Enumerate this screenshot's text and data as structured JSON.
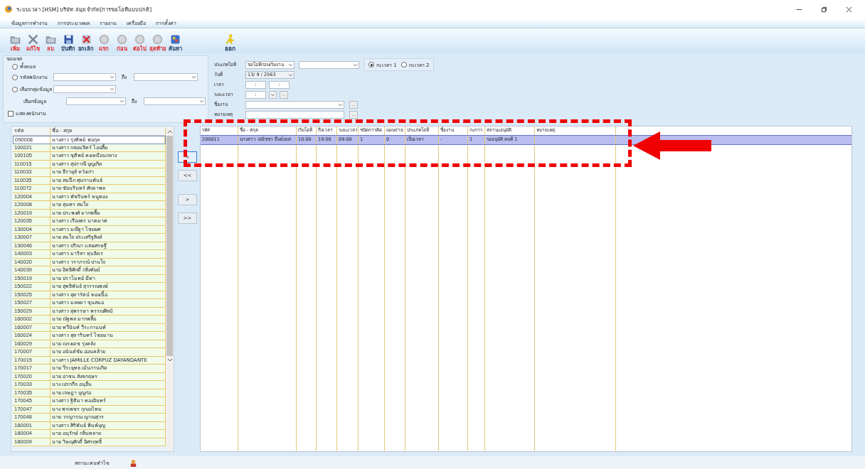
{
  "window": {
    "title": "ระบบเวลา  [HSM]  บริษัท สมุย จำกัด[การขอโอทีแบบปกติ]"
  },
  "menu": [
    "ข้อมูลการทำงาน",
    "การประมวลผล",
    "รายงาน",
    "เครื่องมือ",
    "การตั้งค่า"
  ],
  "toolbar": [
    {
      "label": "เพิ่ม",
      "kind": "folder",
      "color": "#e0201f"
    },
    {
      "label": "แก้ไข",
      "kind": "tools",
      "color": "#e0201f"
    },
    {
      "label": "ลบ",
      "kind": "folder",
      "color": "#e0201f"
    },
    {
      "label": "บันทึก",
      "kind": "save",
      "color": "#1a2f55"
    },
    {
      "label": "ยกเลิก",
      "kind": "cancel",
      "color": "#1a2f55"
    },
    {
      "label": "แรก",
      "kind": "nav",
      "color": "#e0201f"
    },
    {
      "label": "ก่อน",
      "kind": "nav",
      "color": "#e0201f"
    },
    {
      "label": "ต่อไป",
      "kind": "nav",
      "color": "#e0201f"
    },
    {
      "label": "สุดท้าย",
      "kind": "nav",
      "color": "#e0201f"
    },
    {
      "label": "ค้นหา",
      "kind": "search",
      "color": "#1a2f55"
    },
    {
      "label": "ออก",
      "kind": "exit",
      "color": "#1a2f55"
    }
  ],
  "scope": {
    "title": "ขอบเขต",
    "options": [
      {
        "label": "ทั้งหมด",
        "selected": false
      },
      {
        "label": "รหัสพนักงาน",
        "selected": false
      },
      {
        "label": "เลือกกลุ่มข้อมูล",
        "selected": false
      }
    ],
    "to_labels": [
      "ถึง",
      "ถึง"
    ],
    "select_label": "เลือกข้อมูล",
    "show_checkbox": {
      "label": "แสดงพนักงาน",
      "checked": false
    }
  },
  "ot": {
    "type_label": "ประเภทโอที",
    "type_value": "ขอโอทีก่อนเริ่มงาน",
    "shifts": [
      {
        "label": "กะเวลา 1",
        "selected": true
      },
      {
        "label": "กะเวลา 2",
        "selected": false
      }
    ],
    "date_label": "วันที่",
    "date_value": "13/   9 /  2563",
    "time_label": "เวลา",
    "time_values": [
      ":",
      ":"
    ],
    "duration_label": "ระยะเวลา",
    "duration_value": ":",
    "more": [
      "...",
      "...",
      "..."
    ],
    "job_label": "ชื่องาน",
    "note_label": "หมายเหตุ"
  },
  "employees": {
    "columns": [
      "รหัส",
      "ชื่อ - สกุล"
    ],
    "rows": [
      {
        "code": "090008",
        "name": "นางสาว รุ่งทิพย์ พ่อกุล",
        "selected": true
      },
      {
        "code": "100021",
        "name": "นางสาว กล่อมจิตร์ ไอปลื้ม",
        "selected": false
      },
      {
        "code": "100105",
        "name": "นางสาว ชุติพย์ คงเหมือนกลาง",
        "selected": false
      },
      {
        "code": "110015",
        "name": "นางสาว สุปราณี บุญเกิด",
        "selected": false
      },
      {
        "code": "110033",
        "name": "นาย ธีรายุส์ หวังเก่า",
        "selected": false
      },
      {
        "code": "110035",
        "name": "นาย สมนึก ศุนกานพันธ์",
        "selected": false
      },
      {
        "code": "110072",
        "name": "นาย ชัยนรินทร์ ศักดาพล",
        "selected": false
      },
      {
        "code": "120004",
        "name": "นางสาว พัชรินทร์ หนูทอง",
        "selected": false
      },
      {
        "code": "120008",
        "name": "นาย สุนทร สมใจ",
        "selected": false
      },
      {
        "code": "120019",
        "name": "นาย ประพงศ์ มากพลื้ม",
        "selected": false
      },
      {
        "code": "120035",
        "name": "นางสาว เรืองพร นาคมาศ",
        "selected": false
      },
      {
        "code": "130004",
        "name": "นางสาว มณีฐา ไชยยศ",
        "selected": false
      },
      {
        "code": "130007",
        "name": "นาย สมใจ ประเสริฐสิงห์",
        "selected": false
      },
      {
        "code": "130046",
        "name": "นางสาว ปริณา แสงเศรษฐี",
        "selected": false
      },
      {
        "code": "140003",
        "name": "นางสาว มาริสา หุ่นธิดร",
        "selected": false
      },
      {
        "code": "140020",
        "name": "นางสาว วราภรณ์ ปานใจ",
        "selected": false
      },
      {
        "code": "140039",
        "name": "นาย อิทธิศักดิ์ กลิ่งทัยม์",
        "selected": false
      },
      {
        "code": "150019",
        "name": "นาย ปราโมทย์ มีค่า",
        "selected": false
      },
      {
        "code": "150022",
        "name": "นาย สุทธิพันธ์ สุวรรณพงษ์",
        "selected": false
      },
      {
        "code": "150025",
        "name": "นางสาว สุดารัตน์ ทองเนื้อ",
        "selected": false
      },
      {
        "code": "150027",
        "name": "นางสาว มลลดา ขุนสมอ",
        "selected": false
      },
      {
        "code": "150029",
        "name": "นางสาว สุพรรษา พรรณศิลป์",
        "selected": false
      },
      {
        "code": "160002",
        "name": "นาย ณัฐพล มากพลื้ม",
        "selected": false
      },
      {
        "code": "160007",
        "name": "นาย ทวีนันท์ วีระกานนท์",
        "selected": false
      },
      {
        "code": "160024",
        "name": "นางสาว สุดารินทร์ ไชยมาน",
        "selected": false
      },
      {
        "code": "160029",
        "name": "นาย ณรงเดช รุ่งคลัง",
        "selected": false
      },
      {
        "code": "170007",
        "name": "นาย อนันต์ชัย อ่อนคล้าย",
        "selected": false
      },
      {
        "code": "170015",
        "name": "นางสาว JAMILLE CORPUZ DAYANDANTE",
        "selected": false
      },
      {
        "code": "170017",
        "name": "นาย วีระยุทธ เม้นกานเกิด",
        "selected": false
      },
      {
        "code": "170020",
        "name": "นาย อาชน สังขกฤษร",
        "selected": false
      },
      {
        "code": "170033",
        "name": "นาง เปรกกีจ อนุอื่น",
        "selected": false
      },
      {
        "code": "170035",
        "name": "นาย เจษฎา บุญก่อ",
        "selected": false
      },
      {
        "code": "170045",
        "name": "นางสาว ฐิติมา ทองอินทร์",
        "selected": false
      },
      {
        "code": "170047",
        "name": "นาง พรเพชร กุกองไทม",
        "selected": false
      },
      {
        "code": "170048",
        "name": "นาย วรญารณ ญาณสุวร",
        "selected": false
      },
      {
        "code": "180001",
        "name": "นางสาว ศิริพันธ์ พิมพ์บุญ",
        "selected": false
      },
      {
        "code": "180004",
        "name": "นาย อนุรักษ์ กลิ่นทลาย",
        "selected": false
      },
      {
        "code": "180009",
        "name": "นาย วิษณุศักดิ์ อิศรฤทธิ์",
        "selected": false
      }
    ]
  },
  "transfer_buttons": [
    {
      "label": "<",
      "selected": true
    },
    {
      "label": "<<",
      "selected": false
    },
    {
      "label": ">",
      "selected": false
    },
    {
      "label": ">>",
      "selected": false
    }
  ],
  "requests": {
    "columns": [
      "รหัส",
      "ชื่อ - สกุล",
      "เริ่มโอที",
      "ถึงเวลา",
      "ระยะเวลา",
      "ชนิดการคิด",
      "แผนจ่าย",
      "ประเภทโอที",
      "ชื่องาน",
      "กะการ",
      "สถานะอนุมัติ",
      "หมายเหตุ"
    ],
    "rows": [
      {
        "selected": true,
        "cells": [
          "200011",
          "นางสาว ปณิชชา ยืนยั่งยศ",
          "10:00",
          "19:00",
          "09:00",
          "1",
          "0",
          "เป็นเวลา",
          "-",
          "1",
          "รออนุมัติ คนที่ 1",
          ""
        ]
      }
    ]
  },
  "status_bar": {
    "text": "สถานะคนทำไข"
  }
}
